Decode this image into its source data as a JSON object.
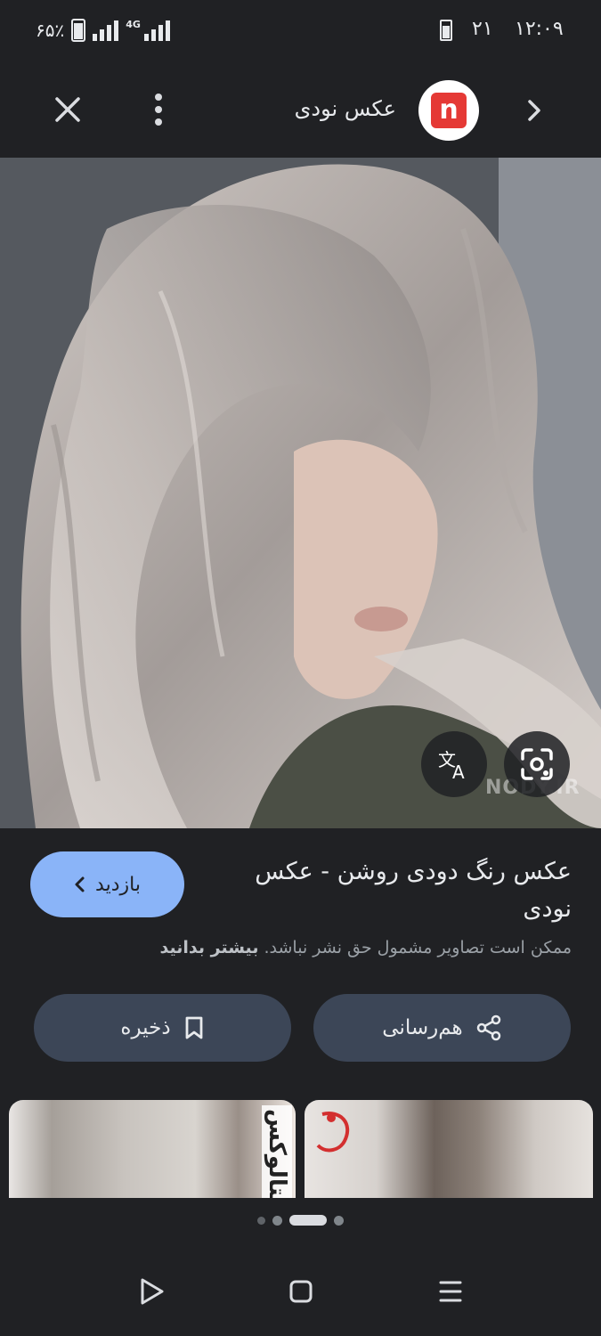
{
  "status_bar": {
    "time": "۱۲:۰۹",
    "notification_count": "۲۱",
    "battery_percent": "۶۵٪",
    "network": "4G"
  },
  "app_bar": {
    "site_title": "عکس نودی",
    "site_logo_letter": "n",
    "icons": {
      "close": "close-icon",
      "menu": "more-vert-icon",
      "forward": "chevron-right-icon"
    }
  },
  "image": {
    "watermark": "NODY.IR",
    "translate_icon": "translate-icon",
    "lens_icon": "lens-search-icon"
  },
  "info": {
    "title": "عکس رنگ دودی روشن - عکس نودی",
    "visit_label": "بازدید",
    "copyright_text": "ممکن است تصاویر مشمول حق نشر نباشد.",
    "learn_more": "بیشتر بدانید"
  },
  "actions": {
    "save_label": "ذخیره",
    "share_label": "هم‌رسانی"
  },
  "related": {
    "left_thumb_text": "ویتالوکس"
  },
  "pagination": {
    "total": 4,
    "active_index": 2
  },
  "colors": {
    "background": "#202124",
    "accent": "#8ab4f8",
    "button_bg": "#3c4657",
    "logo_red": "#e53935"
  }
}
